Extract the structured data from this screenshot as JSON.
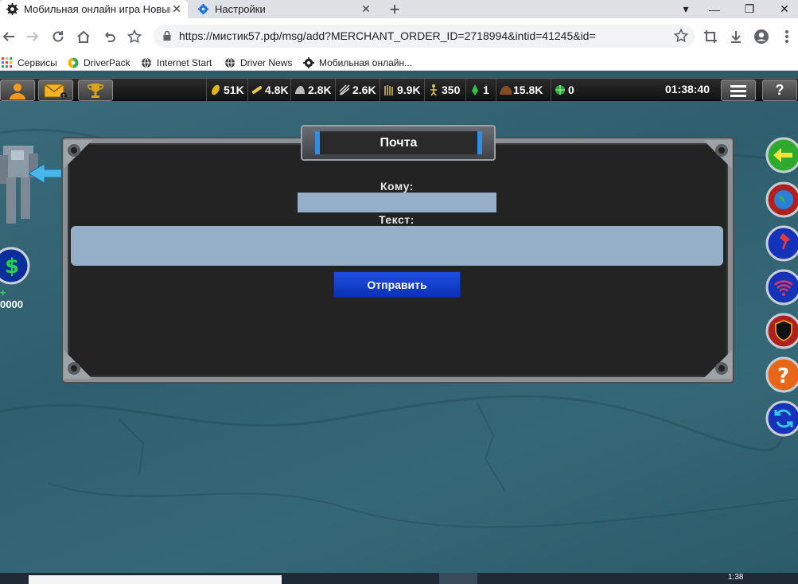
{
  "browser": {
    "tabs": [
      {
        "title": "Мобильная онлайн игра Новый",
        "active": true
      },
      {
        "title": "Настройки",
        "active": false
      }
    ],
    "url": "https://мистик57.рф/msg/add?MERCHANT_ORDER_ID=2718994&intid=41245&id=",
    "bookmarks": [
      "Сервисы",
      "DriverPack",
      "Internet Start",
      "Driver News",
      "Мобильная онлайн..."
    ]
  },
  "hud": {
    "resources": [
      {
        "icon": "gold-coin-icon",
        "value": "51K"
      },
      {
        "icon": "wood-icon",
        "value": "4.8K"
      },
      {
        "icon": "stone-icon",
        "value": "2.8K"
      },
      {
        "icon": "metal-icon",
        "value": "2.6K"
      },
      {
        "icon": "crop-icon",
        "value": "9.9K"
      },
      {
        "icon": "population-icon",
        "value": "350"
      },
      {
        "icon": "green-crystal-icon",
        "value": "1"
      },
      {
        "icon": "soil-icon",
        "value": "15.8K"
      },
      {
        "icon": "gem-icon",
        "value": "0"
      }
    ],
    "time": "01:38:40"
  },
  "mail": {
    "title": "Почта",
    "to_label": "Кому:",
    "text_label": "Текст:",
    "to_value": "",
    "text_value": "",
    "send_label": "Отправить"
  },
  "left": {
    "money_plus": "+",
    "money": "0000"
  },
  "taskbar": {
    "time": "1:38"
  }
}
